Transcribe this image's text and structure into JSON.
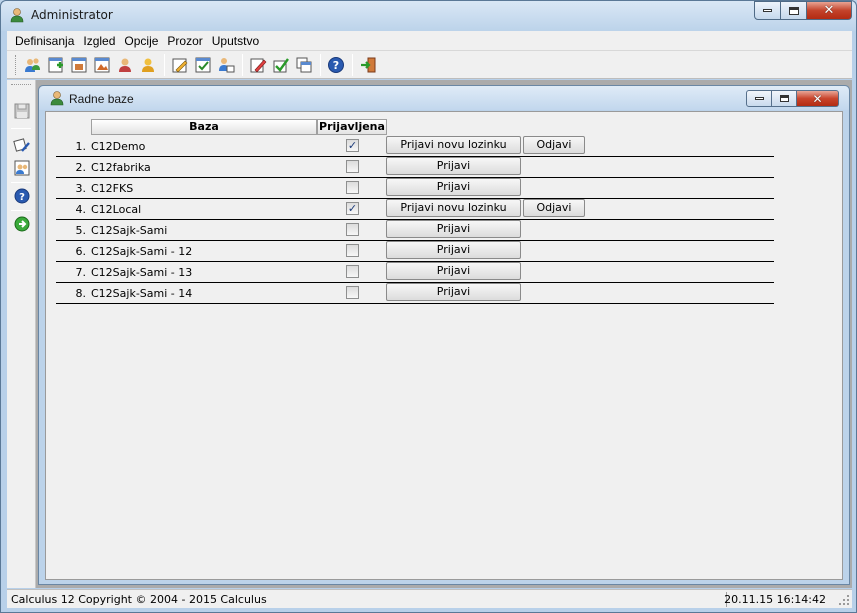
{
  "window": {
    "title": "Administrator"
  },
  "menu": {
    "items": [
      "Definisanja",
      "Izgled",
      "Opcije",
      "Prozor",
      "Uputstvo"
    ]
  },
  "toolbar": {
    "icons": [
      "users-icon",
      "add-database-icon",
      "database-window-icon",
      "image-window-icon",
      "user-group-icon",
      "user-icon",
      "edit-icon",
      "checklist-icon",
      "user-switch-icon",
      "edit-pen-icon",
      "approve-icon",
      "copy-window-icon",
      "help-icon",
      "exit-icon"
    ]
  },
  "child": {
    "title": "Radne baze",
    "headers": {
      "baza": "Baza",
      "prijavljena": "Prijavljena"
    },
    "rows": [
      {
        "num": "1.",
        "name": "C12Demo",
        "checked": true,
        "action": "Prijavi novu lozinku",
        "logout": "Odjavi"
      },
      {
        "num": "2.",
        "name": "C12fabrika",
        "checked": false,
        "action": "Prijavi",
        "logout": ""
      },
      {
        "num": "3.",
        "name": "C12FKS",
        "checked": false,
        "action": "Prijavi",
        "logout": ""
      },
      {
        "num": "4.",
        "name": "C12Local",
        "checked": true,
        "action": "Prijavi novu lozinku",
        "logout": "Odjavi"
      },
      {
        "num": "5.",
        "name": "C12Sajk-Sami",
        "checked": false,
        "action": "Prijavi",
        "logout": ""
      },
      {
        "num": "6.",
        "name": "C12Sajk-Sami - 12",
        "checked": false,
        "action": "Prijavi",
        "logout": ""
      },
      {
        "num": "7.",
        "name": "C12Sajk-Sami - 13",
        "checked": false,
        "action": "Prijavi",
        "logout": ""
      },
      {
        "num": "8.",
        "name": "C12Sajk-Sami - 14",
        "checked": false,
        "action": "Prijavi",
        "logout": ""
      }
    ]
  },
  "status": {
    "left": "Calculus 12  Copyright © 2004 - 2015  Calculus",
    "right": "20.11.15 16:14:42"
  },
  "colors": {
    "titlebar": "#bcd3ea",
    "close": "#c4432b",
    "client": "#ababab"
  }
}
